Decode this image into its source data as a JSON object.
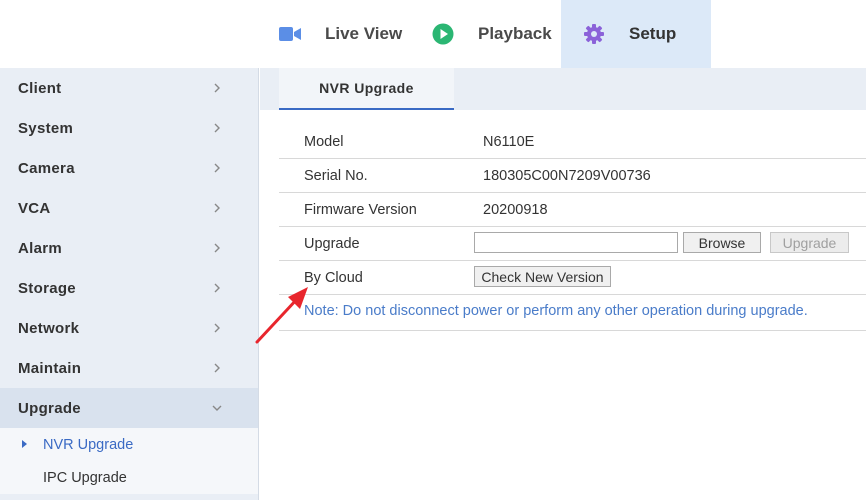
{
  "nav": {
    "items": [
      {
        "label": "Live View",
        "icon": "camera-icon"
      },
      {
        "label": "Playback",
        "icon": "play-icon"
      },
      {
        "label": "Setup",
        "icon": "gear-icon"
      }
    ],
    "active": "Setup"
  },
  "sidebar": {
    "items": [
      {
        "label": "Client"
      },
      {
        "label": "System"
      },
      {
        "label": "Camera"
      },
      {
        "label": "VCA"
      },
      {
        "label": "Alarm"
      },
      {
        "label": "Storage"
      },
      {
        "label": "Network"
      },
      {
        "label": "Maintain"
      },
      {
        "label": "Upgrade"
      }
    ],
    "subitems": [
      {
        "label": "NVR Upgrade"
      },
      {
        "label": "IPC Upgrade"
      }
    ]
  },
  "content": {
    "tab": "NVR Upgrade",
    "rows": [
      {
        "key": "Model",
        "value": "N6110E"
      },
      {
        "key": "Serial No.",
        "value": "180305C00N7209V00736"
      },
      {
        "key": "Firmware Version",
        "value": "20200918"
      },
      {
        "key": "Upgrade"
      },
      {
        "key": "By Cloud"
      }
    ],
    "upgrade_input_value": "",
    "browse_label": "Browse",
    "upgrade_button_label": "Upgrade",
    "check_version_label": "Check New Version",
    "note": "Note: Do not disconnect power or perform any other operation during upgrade."
  },
  "colors": {
    "accent": "#3a6ac4",
    "note": "#4a7cc9",
    "annotation_arrow": "#e8262d",
    "setup_tab_bg": "#dce9f8",
    "camera_icon": "#5b8ee6",
    "play_icon": "#2bb673",
    "gear_icon": "#8b62d9"
  }
}
